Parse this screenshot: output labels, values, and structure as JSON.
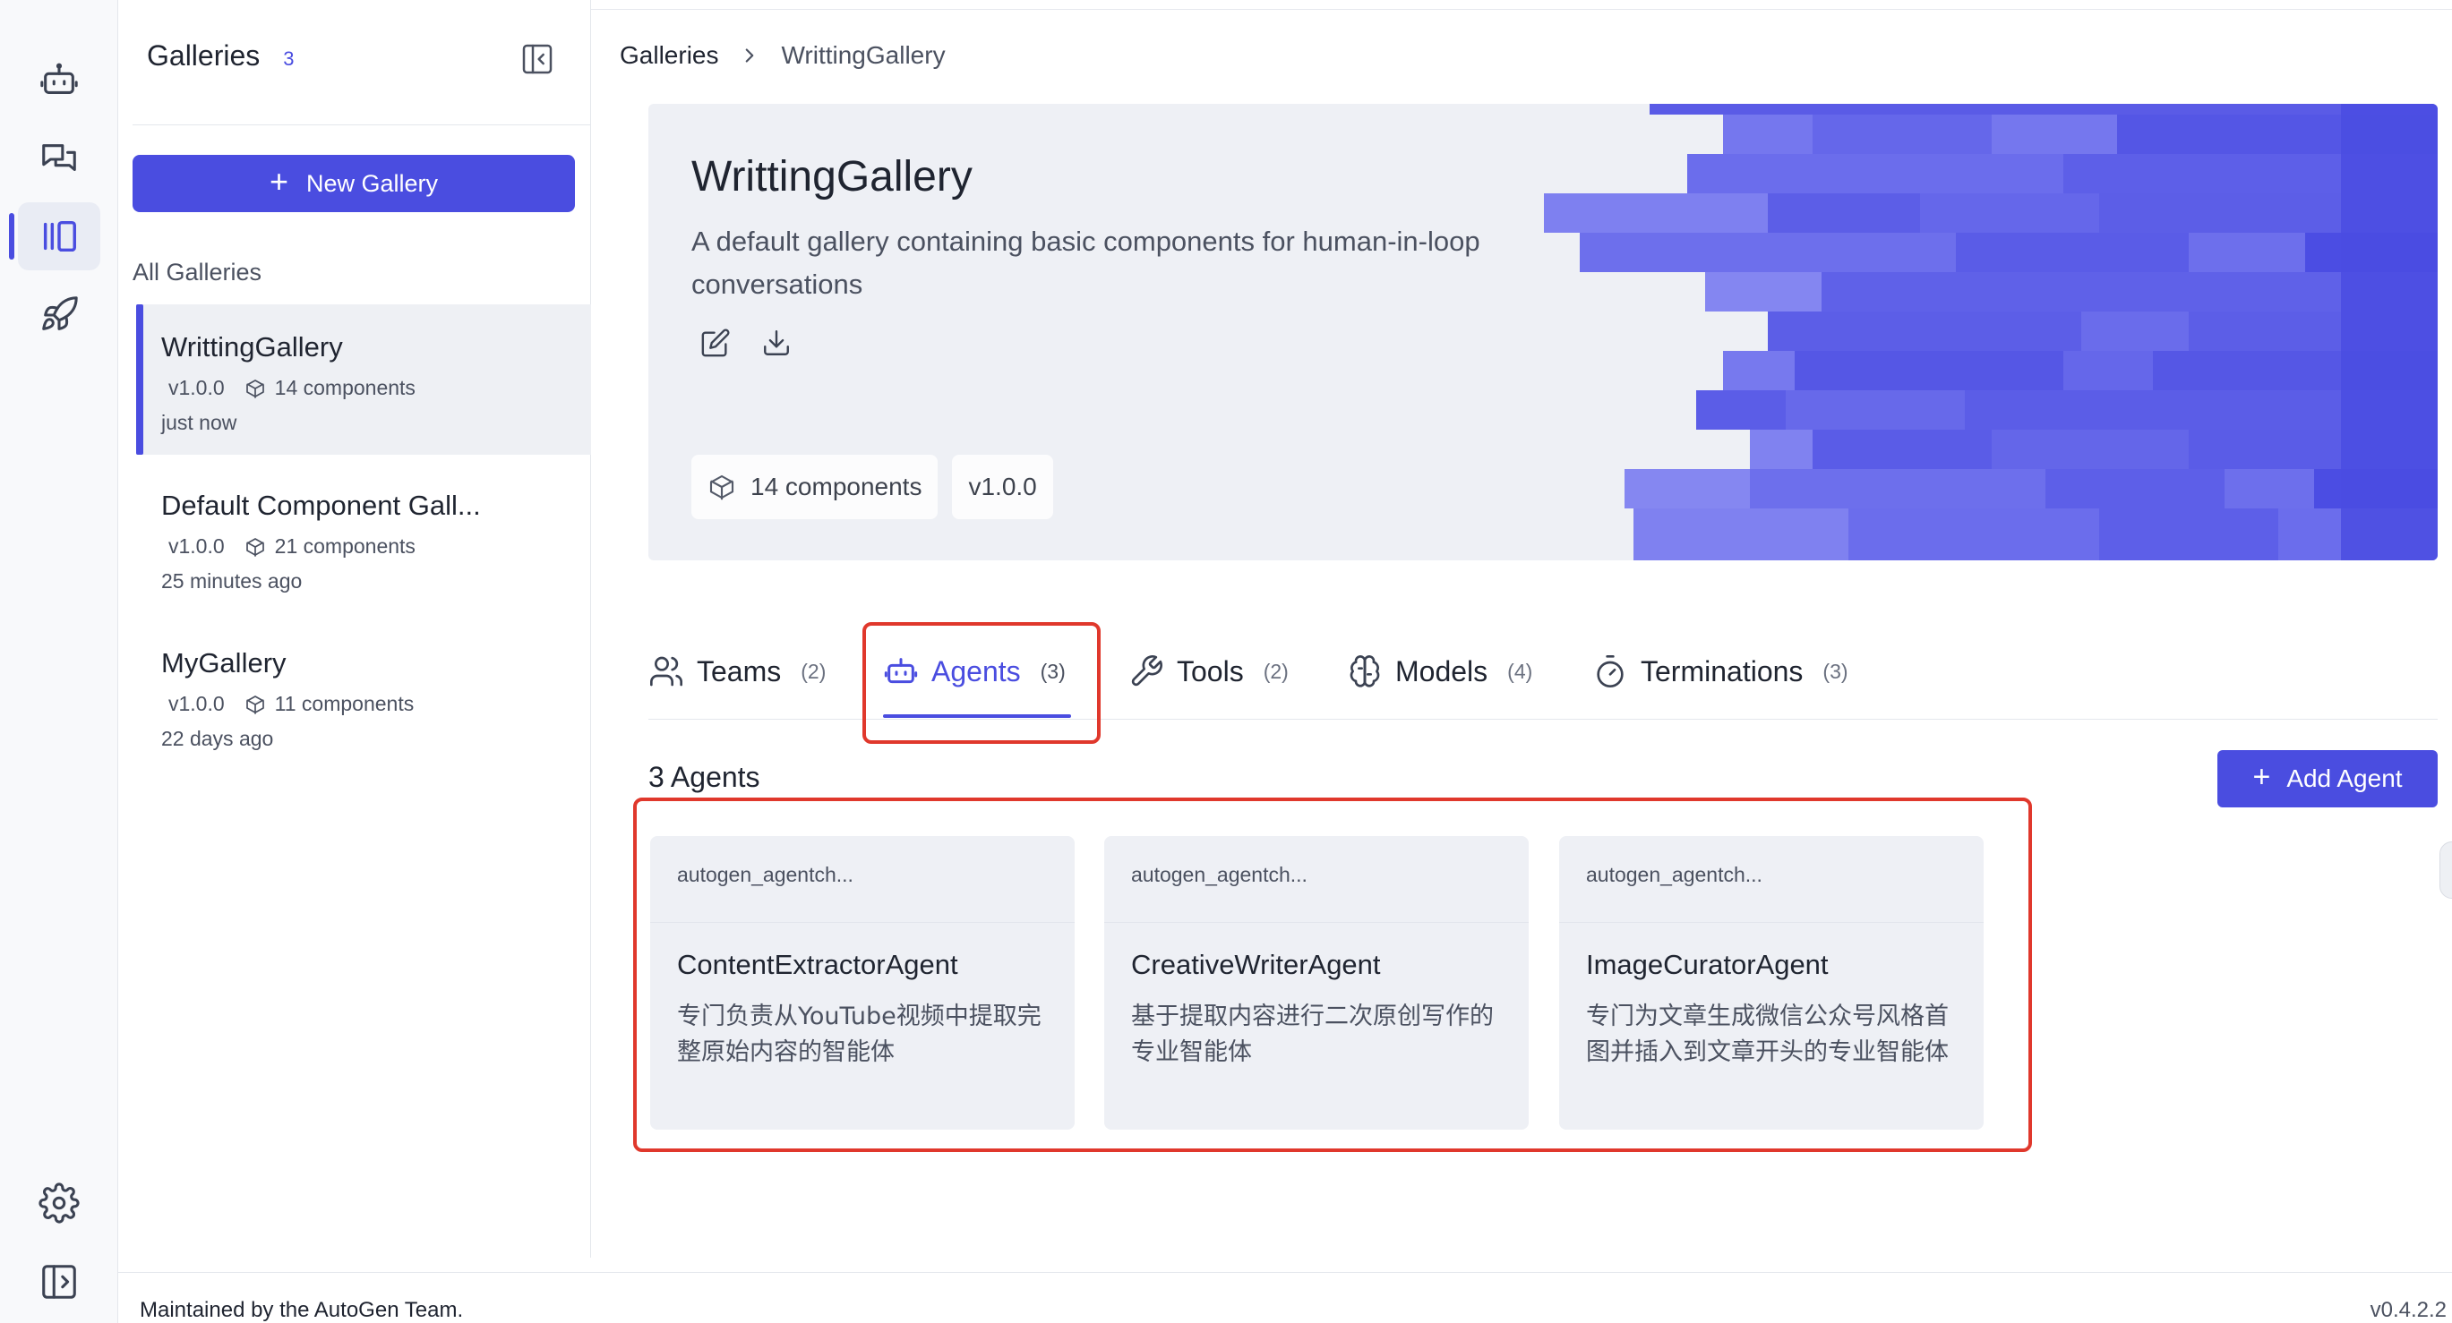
{
  "rail": {
    "items": [
      {
        "name": "agent-bot-icon"
      },
      {
        "name": "chat-icon"
      },
      {
        "name": "gallery-icon"
      },
      {
        "name": "deploy-rocket-icon"
      }
    ],
    "bottom": [
      {
        "name": "settings-gear-icon"
      },
      {
        "name": "expand-sidebar-icon"
      }
    ]
  },
  "sidebar": {
    "title": "Galleries",
    "count": "3",
    "new_button": "New Gallery",
    "section_label": "All Galleries",
    "galleries": [
      {
        "name": "WrittingGallery",
        "version": "v1.0.0",
        "components": "14 components",
        "time": "just now"
      },
      {
        "name": "Default Component Gall...",
        "version": "v1.0.0",
        "components": "21 components",
        "time": "25 minutes ago"
      },
      {
        "name": "MyGallery",
        "version": "v1.0.0",
        "components": "11 components",
        "time": "22 days ago"
      }
    ]
  },
  "breadcrumb": {
    "root": "Galleries",
    "current": "WrittingGallery"
  },
  "banner": {
    "title": "WrittingGallery",
    "description": "A default gallery containing basic components for human-in-loop conversations",
    "components_tag": "14 components",
    "version_tag": "v1.0.0"
  },
  "tabs": [
    {
      "label": "Teams",
      "count": "(2)",
      "icon": "users-icon"
    },
    {
      "label": "Agents",
      "count": "(3)",
      "icon": "agent-bot-icon"
    },
    {
      "label": "Tools",
      "count": "(2)",
      "icon": "wrench-icon"
    },
    {
      "label": "Models",
      "count": "(4)",
      "icon": "brain-icon"
    },
    {
      "label": "Terminations",
      "count": "(3)",
      "icon": "timer-icon"
    }
  ],
  "agents_section": {
    "heading": "3 Agents",
    "add_button": "Add Agent",
    "cards": [
      {
        "provider": "autogen_agentch...",
        "name": "ContentExtractorAgent",
        "description": "专门负责从YouTube视频中提取完整原始内容的智能体"
      },
      {
        "provider": "autogen_agentch...",
        "name": "CreativeWriterAgent",
        "description": "基于提取内容进行二次原创写作的专业智能体"
      },
      {
        "provider": "autogen_agentch...",
        "name": "ImageCuratorAgent",
        "description": "专门为文章生成微信公众号风格首图并插入到文章开头的专业智能体"
      }
    ]
  },
  "footer": {
    "left": "Maintained by the AutoGen Team.",
    "version": "v0.4.2.2"
  },
  "colors": {
    "accent": "#4a4de0",
    "highlight_box": "#e0382c",
    "banner_bg": "#eef0f5"
  }
}
